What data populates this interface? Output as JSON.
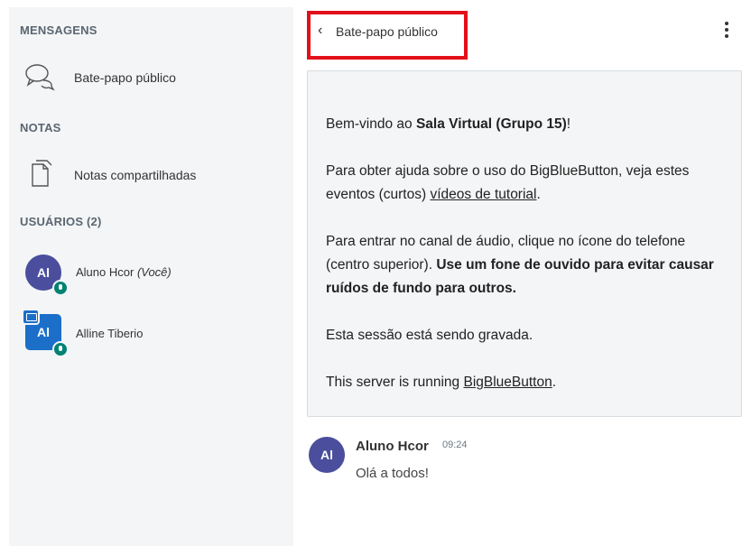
{
  "sidebar": {
    "messages_title": "MENSAGENS",
    "public_chat_label": "Bate-papo público",
    "notes_title": "NOTAS",
    "shared_notes_label": "Notas compartilhadas",
    "users_title": "USUÁRIOS (2)",
    "users": [
      {
        "initials": "Al",
        "name": "Aluno Hcor",
        "you_suffix": "(Você)",
        "avatar_color": "#4a4e9c",
        "shape": "round"
      },
      {
        "initials": "Al",
        "name": "Alline Tiberio",
        "avatar_color": "#1b6fc8",
        "shape": "square",
        "presenter": true
      }
    ]
  },
  "chat": {
    "back_chevron": "‹",
    "title": "Bate-papo público",
    "welcome": {
      "line1_prefix": "Bem-vindo ao ",
      "line1_room": "Sala Virtual (Grupo 15)",
      "line1_suffix": "!",
      "line2_prefix": "Para obter ajuda sobre o uso do BigBlueButton, veja estes eventos (curtos) ",
      "line2_link": "vídeos de tutorial",
      "line2_suffix": ".",
      "line3_prefix": "Para entrar no canal de áudio, clique no ícone do telefone (centro superior).",
      "line3_bold": " Use um fone de ouvido para evitar causar ruídos de fundo para outros.",
      "line4": "Esta sessão está sendo gravada.",
      "line5_prefix": "This server is running ",
      "line5_link": "BigBlueButton",
      "line5_suffix": "."
    },
    "messages": [
      {
        "initials": "Al",
        "author": "Aluno Hcor",
        "time": "09:24",
        "text": "Olá a todos!"
      }
    ]
  },
  "colors": {
    "highlight": "#e3101a",
    "avatar": "#4a4e9c",
    "presenter": "#1b6fc8",
    "mic": "#008272"
  }
}
